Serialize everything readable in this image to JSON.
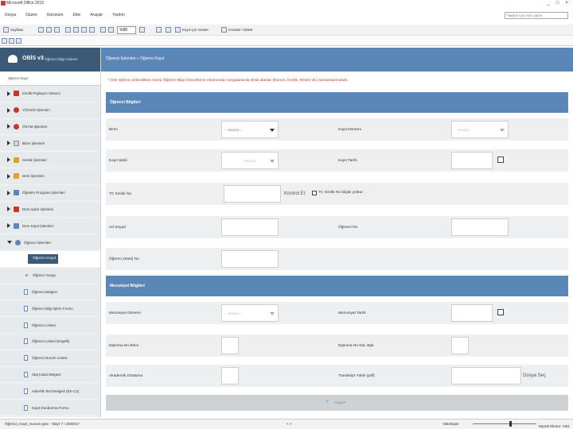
{
  "window": {
    "title": "Microsoft Office 2010",
    "controls": [
      "_",
      "□",
      "×"
    ]
  },
  "menu": {
    "items": [
      "Dosya",
      "Düzen",
      "Görünüm",
      "Ekle",
      "Araçlar",
      "Yardım"
    ],
    "help_placeholder": "Yardım için soru yazın"
  },
  "toolbar": {
    "zoom": "%88",
    "label_1": "Sayfalar",
    "label_2": "Kayıt için Göster",
    "label_3": "Konular / Etiket"
  },
  "sidebar": {
    "brand_name": "OBİS v3",
    "brand_sub": "Öğrenci Bilgi Sistemi",
    "search_label": "öğrenci kayıt",
    "items": [
      {
        "label": "Kimlik Paylaşım Sistemi",
        "color": "#c0392b"
      },
      {
        "label": "YÖKSİS İşlemleri",
        "color": "#c0392b"
      },
      {
        "label": "ÖSYM İşlemleri",
        "color": "#c0392b"
      },
      {
        "label": "Birim İşlemleri",
        "color": "#d6d6d6"
      },
      {
        "label": "Genlik İşlemleri",
        "color": "#e0a030"
      },
      {
        "label": "Ders İşlemleri",
        "color": "#e0a030"
      },
      {
        "label": "Öğretim Programı İşlemleri",
        "color": "#5b87b6"
      },
      {
        "label": "Ders Şube İşlemleri",
        "color": "#c0392b"
      },
      {
        "label": "Ders Kayıt İşlemleri",
        "color": "#5b87b6"
      },
      {
        "label": "Öğrenci İşlemleri",
        "color": "#5b87b6"
      }
    ],
    "subitems": [
      {
        "label": "Öğrenci Kayıt",
        "active": true
      },
      {
        "label": "Öğrenci Sorgu",
        "active": false
      },
      {
        "label": "Öğrenci Belgesi",
        "active": false
      },
      {
        "label": "Öğrenci Bilgi İşlem Formu",
        "active": false
      },
      {
        "label": "Öğrenci Listesi",
        "active": false
      },
      {
        "label": "Öğrenci Listesi (Engelli)",
        "active": false
      },
      {
        "label": "Öğrenci Durum Listesi",
        "active": false
      },
      {
        "label": "Staj Kabul Belgesi",
        "active": false
      },
      {
        "label": "Askerlik Tecil Belgesi (EK-C2)",
        "active": false
      },
      {
        "label": "Kayıt Dondurma Formu",
        "active": false
      }
    ]
  },
  "main": {
    "breadcrumb": "Öğrenci İşlemleri » Öğrenci Kayıt",
    "warning": "* Yeni öğrenci eklendikten sonra Öğrenci Bilgi Güncelleme ekranından sorgulanarak eksik alanlar (Durum, Kimlik, Resim vb.) tamamlanmalıdır.",
    "section_student": "Öğrenci Bilgileri",
    "section_grad": "Mezuniyet Bilgileri",
    "fields": {
      "birim": "Birim",
      "birim_value": "-- Seçiniz --",
      "kayit_donemi": "Kayıt Dönemi",
      "kayit_donemi_value": "-- Seçiniz --",
      "kayit_sekli": "Kayıt Şekli",
      "kayit_sekli_value": "Seçiniz",
      "kayit_tarihi": "Kayıt Tarihi",
      "tc": "TC Kimlik No",
      "kontrol": "Kontrol Et",
      "tc_yok": "TC Kimlik No bilgisi yoktur.",
      "ad_soyad": "Ad Soyad",
      "ogrenci_no": "Öğrenci No",
      "eski_no": "Öğrenci (Eski) No",
      "mezuniyet_donemi": "Mezuniyet Dönemi",
      "mezuniyet_donemi_value": "-- Seçiniz --",
      "mezuniyet_tarihi": "Mezuniyet Tarihi",
      "mezuniyet_tarihi_value": "-",
      "diploma_birim": "Diploma No Birim",
      "diploma_dal": "Diploma No Dal. Bşk.",
      "akademik": "Akademik Ortalama",
      "transkript": "Transkript Yükle (pdf)",
      "dosya_sec": "Dosya Seç"
    },
    "save_label": "Kaydet"
  },
  "status": {
    "left": "Öğrenci_Kayıt_Sunum.pptx - Slayt 7 / 2005017",
    "center": "< >",
    "zoom_label": "Yakınlaştır",
    "right": "Yaprak Ekranı: %81"
  }
}
